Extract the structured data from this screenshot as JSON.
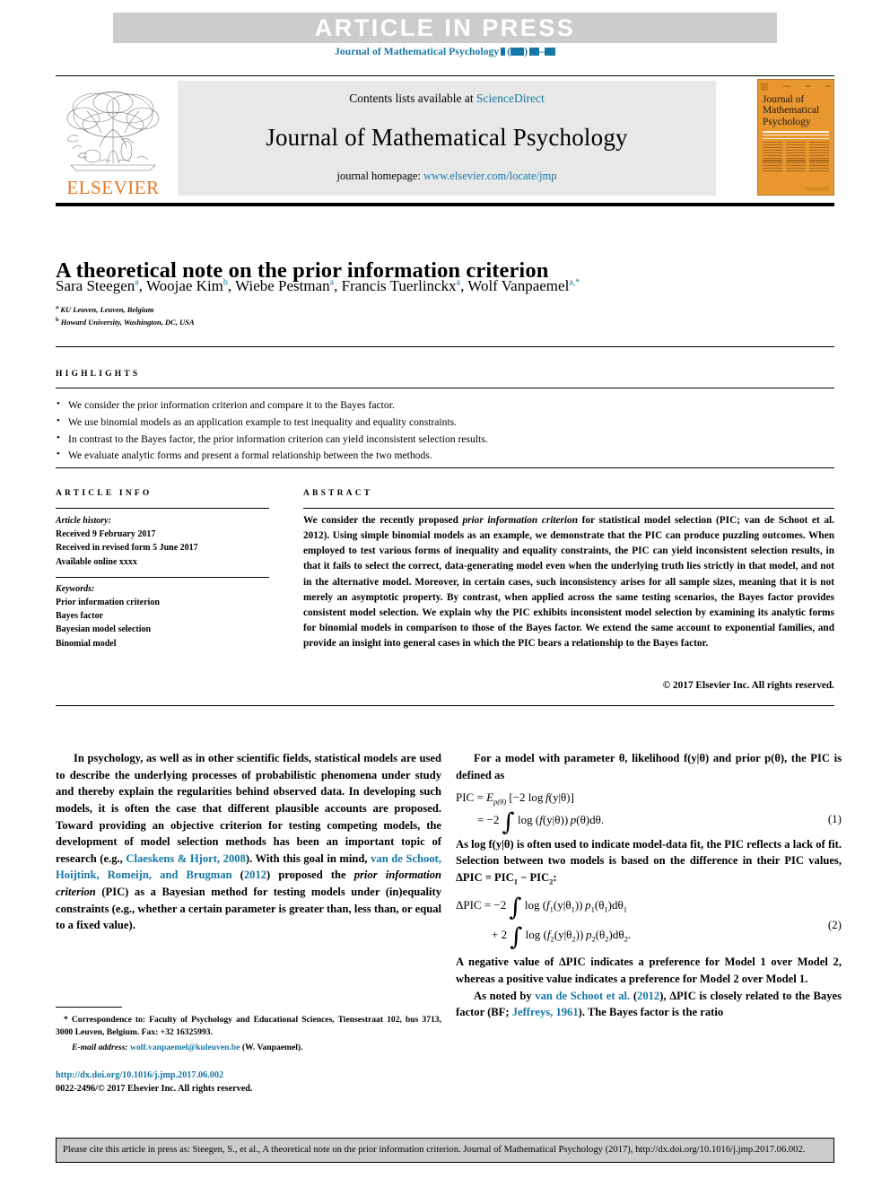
{
  "banner": {
    "text": "ARTICLE  IN  PRESS",
    "journal_ref_prefix": "Journal of Mathematical Psychology",
    "accent_color": "#1577a5",
    "banner_bg": "#cccccc"
  },
  "masthead": {
    "contents_text": "Contents lists available at",
    "contents_link": "ScienceDirect",
    "journal_name": "Journal of Mathematical Psychology",
    "homepage_label": "journal homepage:",
    "homepage_link": "www.elsevier.com/locate/jmp",
    "publisher": "ELSEVIER",
    "publisher_color": "#E87722",
    "cover": {
      "title_line1": "Journal of",
      "title_line2": "Mathematical",
      "title_line3": "Psychology",
      "bg_color": "#E8962E"
    }
  },
  "article": {
    "title": "A theoretical note on the prior information criterion",
    "authors": [
      {
        "name": "Sara Steegen",
        "sup": "a"
      },
      {
        "name": "Woojae Kim",
        "sup": "b"
      },
      {
        "name": "Wiebe Pestman",
        "sup": "a"
      },
      {
        "name": "Francis Tuerlinckx",
        "sup": "a"
      },
      {
        "name": "Wolf Vanpaemel",
        "sup": "a,*"
      }
    ],
    "affiliations": [
      {
        "sup": "a",
        "text": "KU Leuven, Leuven, Belgium"
      },
      {
        "sup": "b",
        "text": "Howard University, Washington, DC, USA"
      }
    ]
  },
  "highlights": {
    "heading": "HIGHLIGHTS",
    "items": [
      "We consider the prior information criterion and compare it to the Bayes factor.",
      "We use binomial models as an application example to test inequality and equality constraints.",
      "In contrast to the Bayes factor, the prior information criterion can yield inconsistent selection results.",
      "We evaluate analytic forms and present a formal relationship between the two methods."
    ]
  },
  "article_info": {
    "heading": "ARTICLE INFO",
    "history_label": "Article history:",
    "history": [
      "Received 9 February 2017",
      "Received in revised form 5 June 2017",
      "Available online xxxx"
    ],
    "keywords_label": "Keywords:",
    "keywords": [
      "Prior information criterion",
      "Bayes factor",
      "Bayesian model selection",
      "Binomial model"
    ]
  },
  "abstract": {
    "heading": "ABSTRACT",
    "text_part1": "We consider the recently proposed ",
    "italic1": "prior information criterion",
    "text_part2": " for statistical model selection (PIC; van de Schoot et al. 2012). Using simple binomial models as an example, we demonstrate that the PIC can produce puzzling outcomes. When employed to test various forms of inequality and equality constraints, the PIC can yield inconsistent selection results, in that it fails to select the correct, data-generating model even when the underlying truth lies strictly in that model, and not in the alternative model. Moreover, in certain cases, such inconsistency arises for all sample sizes, meaning that it is not merely an asymptotic property. By contrast, when applied across the same testing scenarios, the Bayes factor provides consistent model selection. We explain why the PIC exhibits inconsistent model selection by examining its analytic forms for binomial models in comparison to those of the Bayes factor. We extend the same account to exponential families, and provide an insight into general cases in which the PIC bears a relationship to the Bayes factor.",
    "copyright": "© 2017 Elsevier Inc. All rights reserved."
  },
  "body": {
    "left": {
      "para1_a": "In psychology, as well as in other scientific fields, statistical models are used to describe the underlying processes of probabilistic phenomena under study and thereby explain the regularities behind observed data. In developing such models, it is often the case that different plausible accounts are proposed. Toward providing an objective criterion for testing competing models, the development of model selection methods has been an important topic of research  (e.g., ",
      "ref1": "Claeskens & Hjort, 2008",
      "para1_b": "). With this goal in mind,  ",
      "ref2": "van de Schoot, Hoijtink, Romeijn, and Brugman",
      "para1_c": " (",
      "ref3": "2012",
      "para1_d": ") proposed the ",
      "italic1": "prior information criterion",
      "para1_e": " (PIC) as a Bayesian method for testing models under (in)equality constraints (e.g., whether a certain parameter is greater than, less than, or equal to a fixed value)."
    },
    "right": {
      "para1": "For a model with parameter θ, likelihood f(y|θ) and prior p(θ), the PIC is defined as",
      "eq1_line1": "PIC = E",
      "eq1_sub": "p(θ)",
      "eq1_line1b": " [−2 log f(y|θ)]",
      "eq1_line2": "= −2 ∫ log (f(y|θ)) p(θ)dθ.",
      "eq1_number": "(1)",
      "para2_a": "As log f(y|θ) is often used to indicate model-data fit, the PIC reflects a lack of fit. Selection between two models is based on the difference in their PIC values, ΔPIC = PIC",
      "para2_sub1": "1",
      "para2_b": " − PIC",
      "para2_sub2": "2",
      "para2_c": ":",
      "eq2_line1": "ΔPIC = −2 ∫ log (f₁(y|θ₁)) p₁(θ₁)dθ₁",
      "eq2_line2": "+ 2 ∫ log (f₂(y|θ₂)) p₂(θ₂)dθ₂.",
      "eq2_number": "(2)",
      "para3": "A negative value of ΔPIC indicates a preference for Model 1 over Model 2, whereas a positive value indicates a preference for Model 2 over Model 1.",
      "para4_a": "As noted by  ",
      "ref1": "van de Schoot et al.",
      "para4_b": " (",
      "ref2": "2012",
      "para4_c": "), ΔPIC is closely related to the Bayes factor  (BF; ",
      "ref3": "Jeffreys, 1961",
      "para4_d": "). The Bayes factor is the ratio"
    }
  },
  "footnote": {
    "correspondence": "* Correspondence to: Faculty of Psychology and Educational Sciences, Tiensestraat 102, bus 3713, 3000 Leuven, Belgium. Fax: +32 16325993.",
    "email_label": "E-mail address:",
    "email": "wolf.vanpaemel@kuleuven.be",
    "email_owner": " (W. Vanpaemel).",
    "doi": "http://dx.doi.org/10.1016/j.jmp.2017.06.002",
    "issn_copyright": "0022-2496/© 2017 Elsevier Inc. All rights reserved."
  },
  "citation_box": {
    "text": "Please cite this article in press as: Steegen, S., et al., A theoretical note on the prior information criterion. Journal of Mathematical Psychology (2017), http://dx.doi.org/10.1016/j.jmp.2017.06.002."
  }
}
